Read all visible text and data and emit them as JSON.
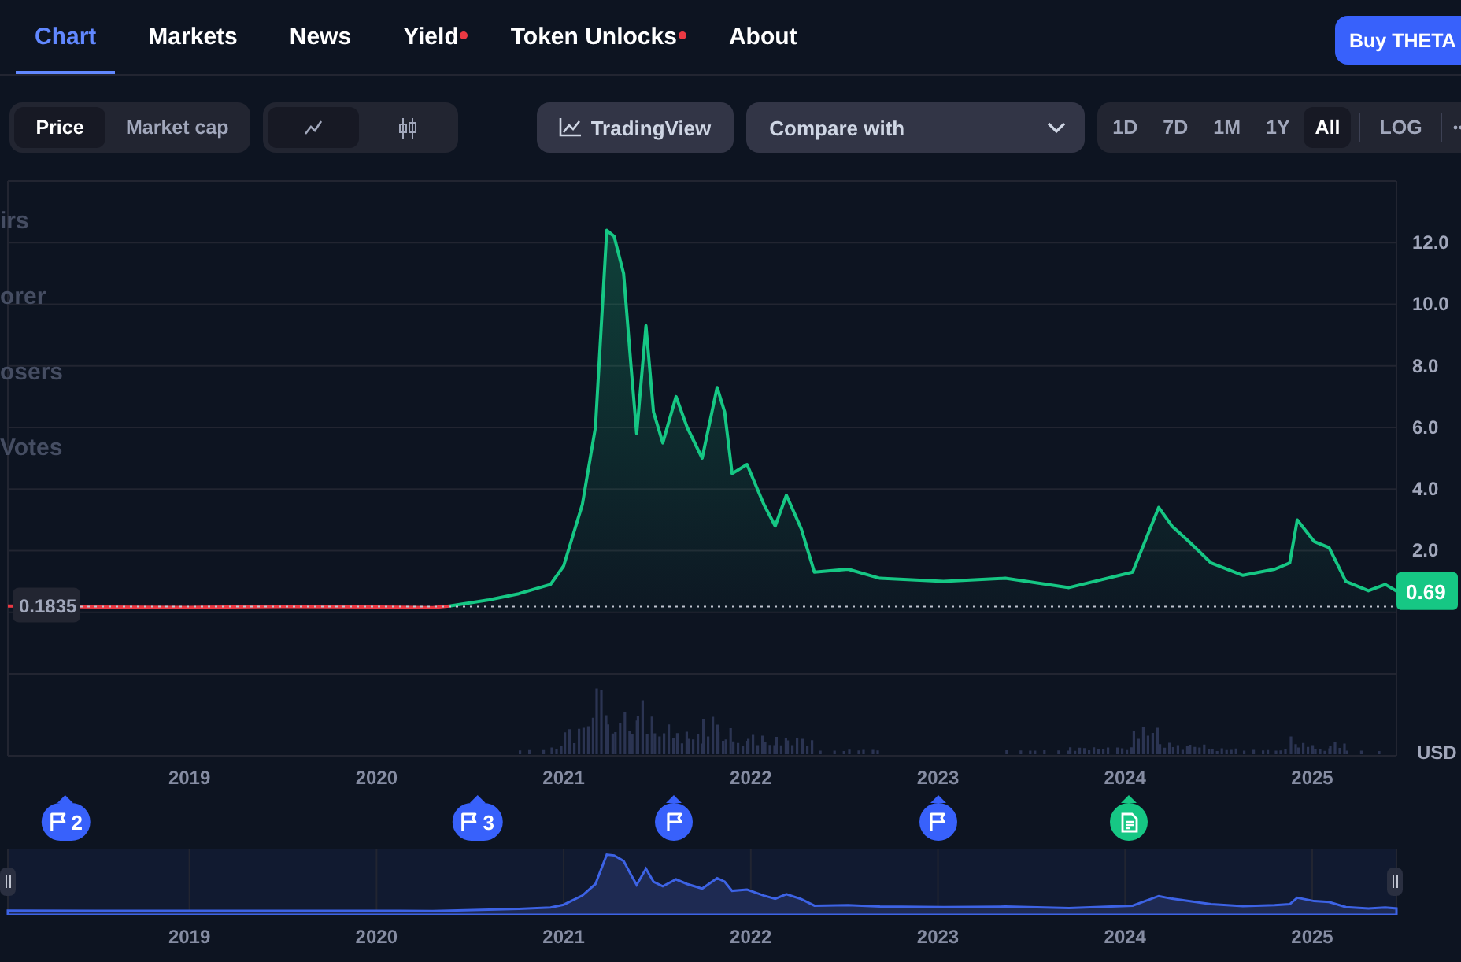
{
  "nav": {
    "tabs": [
      {
        "label": "Chart",
        "selected": true,
        "badge": false
      },
      {
        "label": "Markets",
        "selected": false,
        "badge": false
      },
      {
        "label": "News",
        "selected": false,
        "badge": false
      },
      {
        "label": "Yield",
        "selected": false,
        "badge": true
      },
      {
        "label": "Token Unlocks",
        "selected": false,
        "badge": true
      },
      {
        "label": "About",
        "selected": false,
        "badge": false
      }
    ],
    "buy_button": "Buy THETA"
  },
  "toolbar": {
    "metric": [
      {
        "label": "Price",
        "selected": true
      },
      {
        "label": "Market cap",
        "selected": false
      }
    ],
    "chart_type": [
      {
        "kind": "line",
        "selected": true
      },
      {
        "kind": "candles",
        "selected": false
      }
    ],
    "tradingview": "TradingView",
    "compare": {
      "placeholder": "Compare with"
    },
    "ranges": [
      {
        "label": "1D",
        "selected": false
      },
      {
        "label": "7D",
        "selected": false
      },
      {
        "label": "1M",
        "selected": false
      },
      {
        "label": "1Y",
        "selected": false
      },
      {
        "label": "All",
        "selected": true
      }
    ],
    "log": "LOG"
  },
  "ghost_labels": [
    "irs",
    "orer",
    "osers",
    "Votes"
  ],
  "chart": {
    "start_price": "0.1835",
    "last_price": "0.69",
    "unit": "USD",
    "chart_data": {
      "type": "line",
      "x": [
        2018.03,
        2018.5,
        2019,
        2019.5,
        2020,
        2020.3,
        2020.39,
        2020.6,
        2020.76,
        2020.93,
        2021.0,
        2021.1,
        2021.17,
        2021.23,
        2021.27,
        2021.32,
        2021.36,
        2021.39,
        2021.44,
        2021.48,
        2021.53,
        2021.6,
        2021.66,
        2021.74,
        2021.82,
        2021.86,
        2021.9,
        2021.98,
        2022.07,
        2022.13,
        2022.19,
        2022.27,
        2022.34,
        2022.52,
        2022.69,
        2023.03,
        2023.36,
        2023.7,
        2024.04,
        2024.18,
        2024.25,
        2024.34,
        2024.46,
        2024.63,
        2024.8,
        2024.88,
        2024.92,
        2025.01,
        2025.09,
        2025.18,
        2025.3,
        2025.39,
        2025.45
      ],
      "series": [
        {
          "color": "#ea3943",
          "values": [
            0.2,
            0.17,
            0.16,
            0.18,
            0.17,
            0.15,
            0.2,
            null,
            null,
            null,
            null,
            null,
            null,
            null,
            null,
            null,
            null,
            null,
            null,
            null,
            null,
            null,
            null,
            null,
            null,
            null,
            null,
            null,
            null,
            null,
            null,
            null,
            null,
            null,
            null,
            null,
            null,
            null,
            null,
            null,
            null,
            null,
            null,
            null,
            null,
            null,
            null,
            null,
            null,
            null,
            null,
            null,
            null
          ]
        },
        {
          "color": "#16c784",
          "values": [
            null,
            null,
            null,
            null,
            null,
            null,
            0.2,
            0.4,
            0.6,
            0.9,
            1.5,
            3.5,
            6,
            12.4,
            12.2,
            11,
            8,
            5.8,
            9.3,
            6.5,
            5.5,
            7,
            6,
            5,
            7.3,
            6.5,
            4.5,
            4.8,
            3.5,
            2.8,
            3.8,
            2.7,
            1.3,
            1.4,
            1.1,
            1.0,
            1.1,
            0.8,
            1.3,
            3.4,
            2.8,
            2.3,
            1.6,
            1.2,
            1.4,
            1.6,
            3.0,
            2.3,
            2.1,
            1.0,
            0.7,
            0.9,
            0.69
          ]
        }
      ],
      "xlim": [
        2018.03,
        2025.45
      ],
      "ylim": [
        -4.66,
        14
      ],
      "grid": true,
      "xticks": [
        {
          "value": 2019,
          "label": "2019"
        },
        {
          "value": 2020,
          "label": "2020"
        },
        {
          "value": 2021,
          "label": "2021"
        },
        {
          "value": 2022,
          "label": "2022"
        },
        {
          "value": 2023,
          "label": "2023"
        },
        {
          "value": 2024,
          "label": "2024"
        },
        {
          "value": 2025,
          "label": "2025"
        }
      ],
      "yticks": [
        {
          "value": 2,
          "label": "2.0"
        },
        {
          "value": 4,
          "label": "4.0"
        },
        {
          "value": 6,
          "label": "6.0"
        },
        {
          "value": 8,
          "label": "8.0"
        },
        {
          "value": 10,
          "label": "10.0"
        },
        {
          "value": 12,
          "label": "12.0"
        }
      ]
    }
  },
  "events": [
    {
      "kind": "flag",
      "count": "2",
      "color": "#3861fb"
    },
    {
      "kind": "flag",
      "count": "3",
      "color": "#3861fb"
    },
    {
      "kind": "flag",
      "color": "#3861fb"
    },
    {
      "kind": "flag",
      "color": "#3861fb"
    },
    {
      "kind": "document",
      "color": "#16c784"
    }
  ],
  "navigator": {
    "year_labels": [
      "2019",
      "2020",
      "2021",
      "2022",
      "2023",
      "2024",
      "2025"
    ]
  }
}
